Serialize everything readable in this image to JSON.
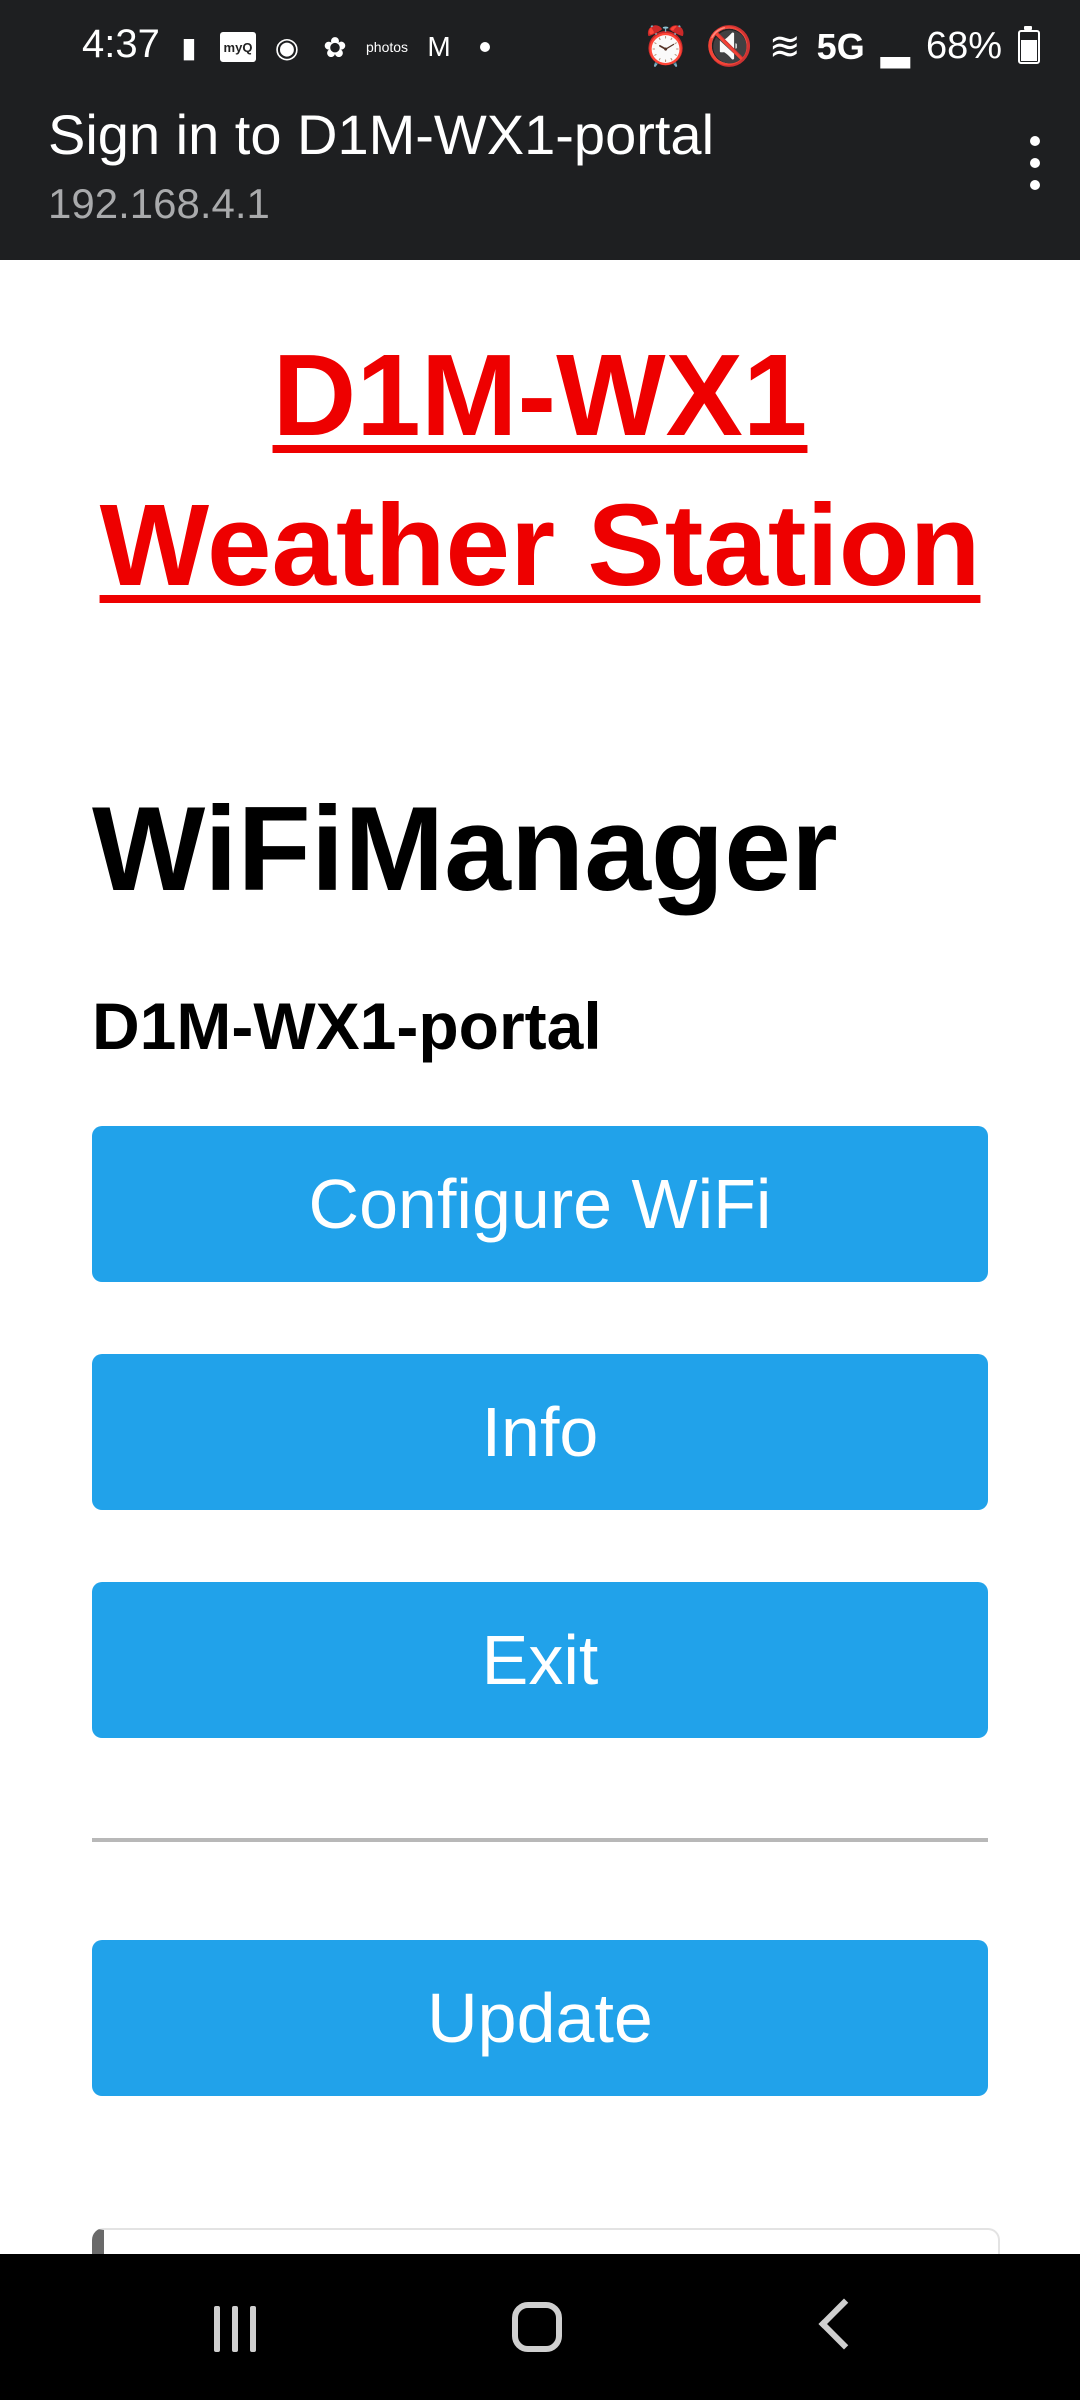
{
  "status_bar": {
    "time": "4:37",
    "photos_label": "photos",
    "myq_label": "myQ",
    "network": "5G",
    "battery": "68%"
  },
  "title_bar": {
    "title": "Sign in to D1M-WX1-portal",
    "url": "192.168.4.1"
  },
  "page": {
    "brand_line1": "D1M-WX1",
    "brand_line2": "Weather Station",
    "heading": "WiFiManager",
    "portal_name": "D1M-WX1-portal",
    "buttons": {
      "configure_wifi": "Configure WiFi",
      "info": "Info",
      "exit": "Exit",
      "update": "Update"
    }
  },
  "colors": {
    "brand_red": "#ee0000",
    "button_blue": "#21a2ea",
    "bar_dark": "#1e1f21"
  }
}
